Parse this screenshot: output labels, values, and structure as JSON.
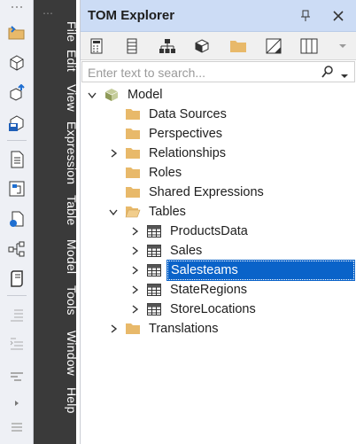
{
  "menu": {
    "items": [
      "File",
      "Edit",
      "View",
      "Expression",
      "Table",
      "Model",
      "Tools",
      "Window",
      "Help"
    ]
  },
  "left_toolbar": {
    "icons": [
      "open-folder-icon",
      "cube-icon",
      "cube-upload-icon",
      "save-cube-icon",
      "document-icon",
      "dependency-icon",
      "deploy-icon",
      "hierarchy-icon",
      "script-icon",
      "indent-icon",
      "outdent-icon",
      "format-icon",
      "scroll-arrow-icon",
      "comment-icon"
    ]
  },
  "panel": {
    "title": "TOM Explorer",
    "search_placeholder": "Enter text to search..."
  },
  "tree": {
    "root": "Model",
    "items": [
      {
        "label": "Data Sources",
        "expandable": false
      },
      {
        "label": "Perspectives",
        "expandable": false
      },
      {
        "label": "Relationships",
        "expandable": true,
        "expanded": false
      },
      {
        "label": "Roles",
        "expandable": false
      },
      {
        "label": "Shared Expressions",
        "expandable": false
      },
      {
        "label": "Tables",
        "expandable": true,
        "expanded": true
      }
    ],
    "tables": [
      {
        "label": "ProductsData",
        "selected": false
      },
      {
        "label": "Sales",
        "selected": false
      },
      {
        "label": "Salesteams",
        "selected": true
      },
      {
        "label": "StateRegions",
        "selected": false
      },
      {
        "label": "StoreLocations",
        "selected": false
      }
    ],
    "last": {
      "label": "Translations",
      "expandable": true
    }
  },
  "colors": {
    "title_bar": "#ccdcf5",
    "selection": "#0a63c9",
    "menu_strip": "#3a3a3a",
    "folder": "#e8b96a"
  }
}
